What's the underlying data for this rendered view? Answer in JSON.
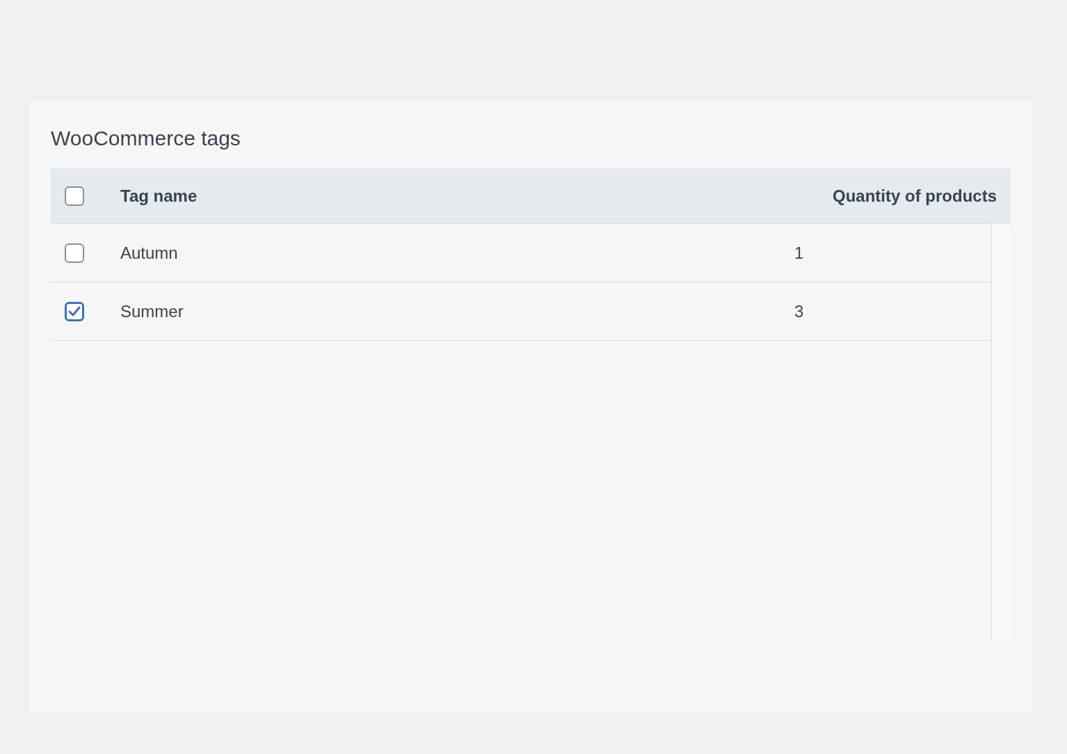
{
  "title": "WooCommerce tags",
  "table": {
    "select_all": {
      "checked": false
    },
    "columns": [
      "Tag name",
      "Quantity of products"
    ],
    "rows": [
      {
        "name": "Autumn",
        "quantity": "1",
        "checked": false
      },
      {
        "name": "Summer",
        "quantity": "3",
        "checked": true
      }
    ]
  }
}
